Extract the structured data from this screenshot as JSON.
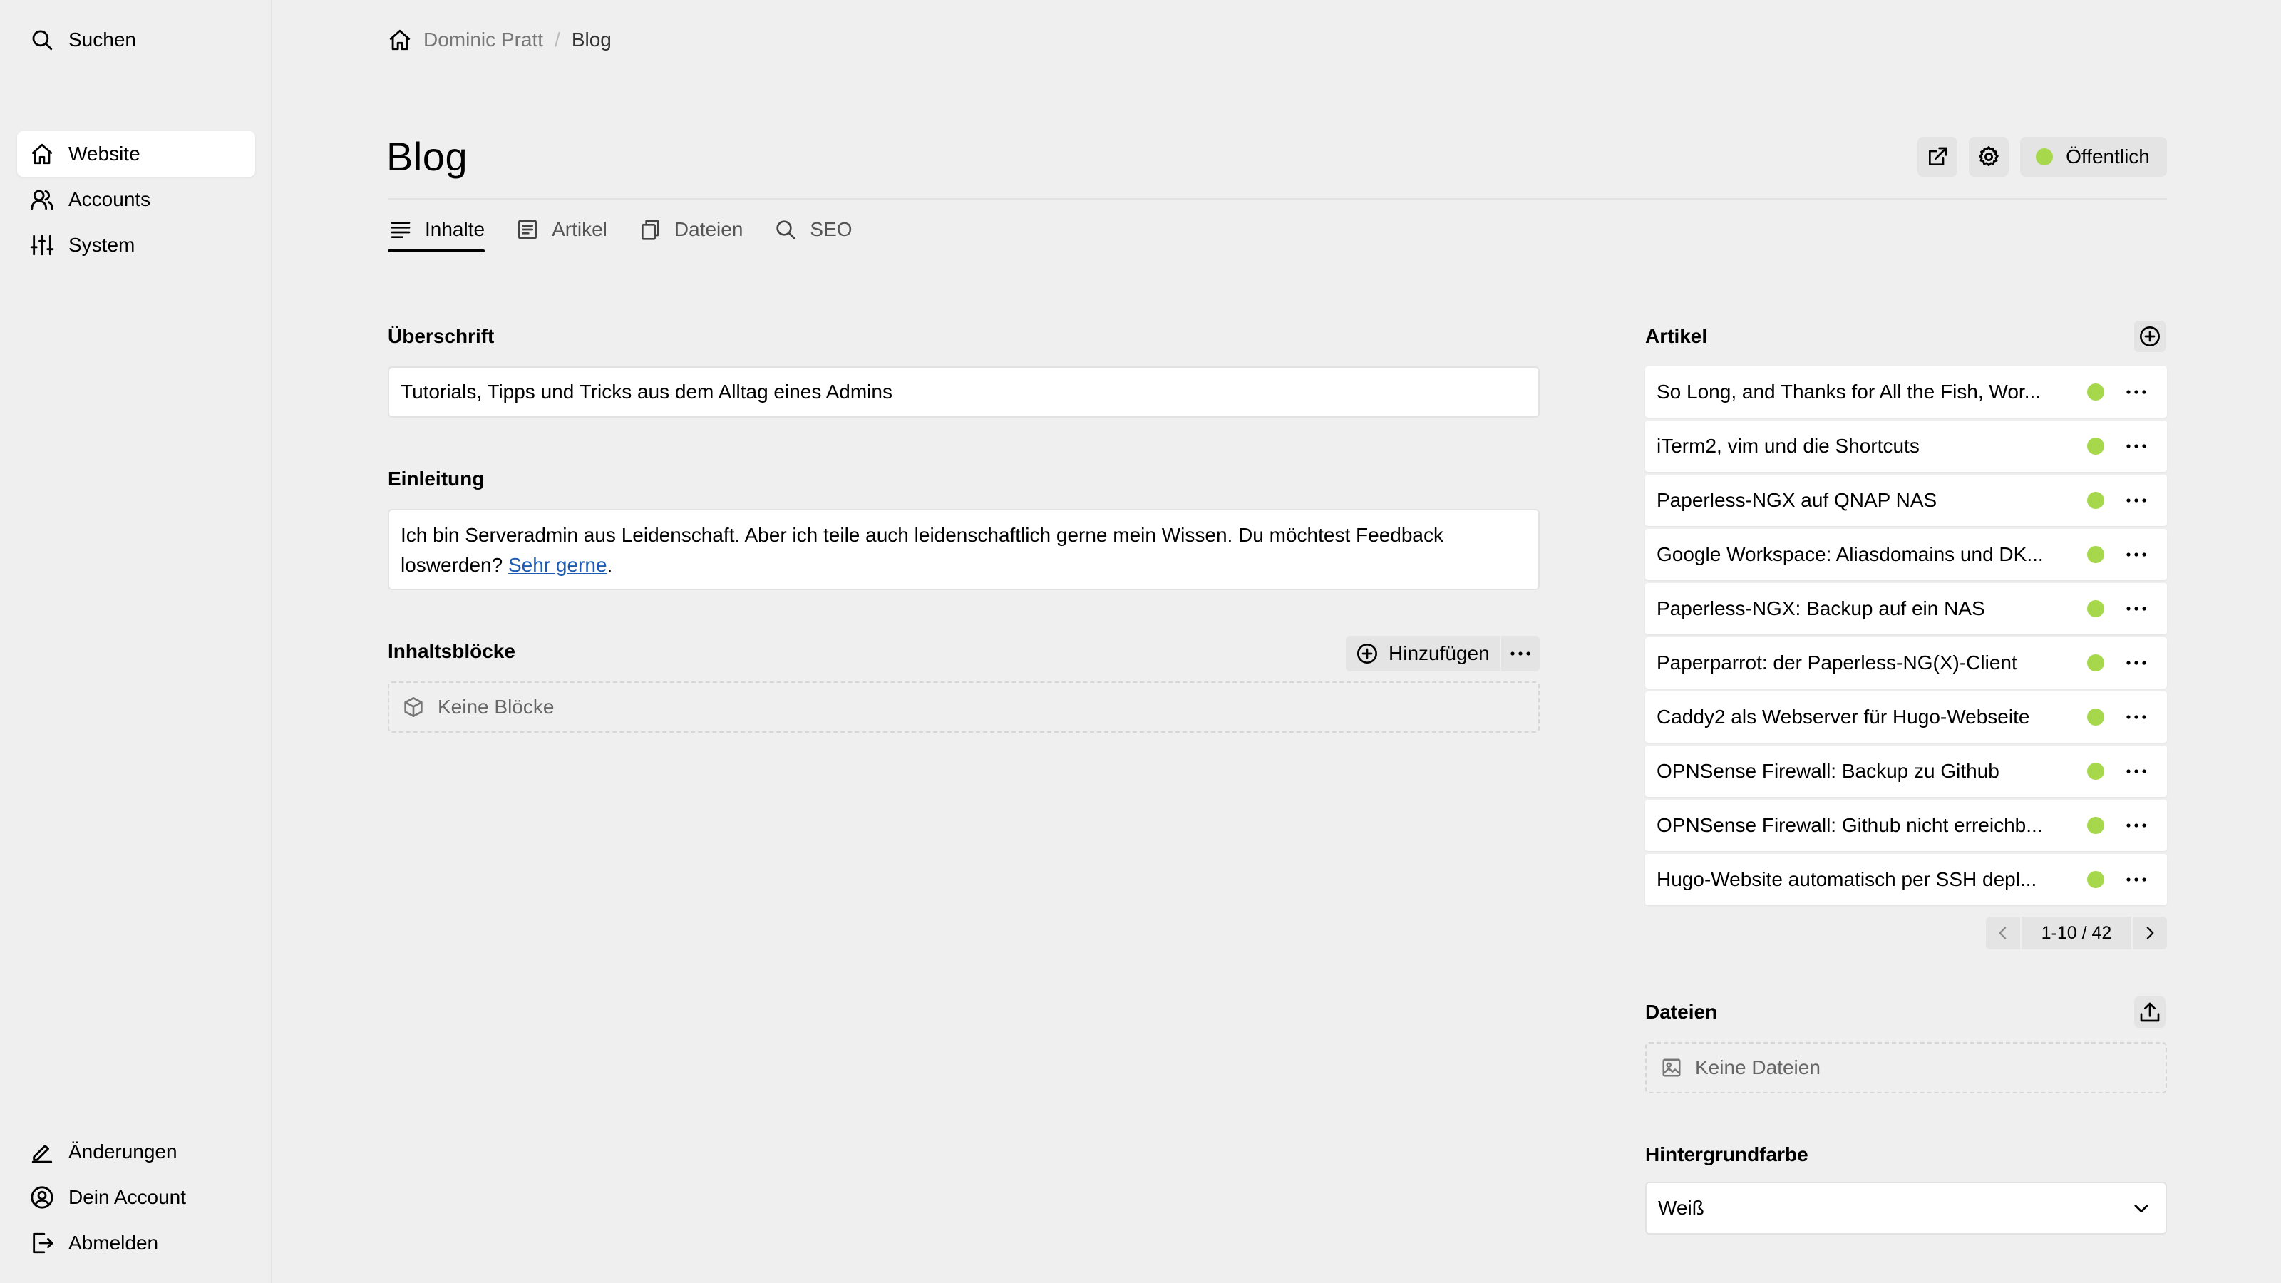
{
  "sidebar": {
    "search_label": "Suchen",
    "nav": [
      {
        "label": "Website",
        "icon": "home-icon",
        "active": true
      },
      {
        "label": "Accounts",
        "icon": "users-icon",
        "active": false
      },
      {
        "label": "System",
        "icon": "sliders-icon",
        "active": false
      }
    ],
    "bottom": [
      {
        "label": "Änderungen",
        "icon": "edit-icon"
      },
      {
        "label": "Dein Account",
        "icon": "user-circle-icon"
      },
      {
        "label": "Abmelden",
        "icon": "logout-icon"
      }
    ]
  },
  "breadcrumb": {
    "root": "Dominic Pratt",
    "separator": "/",
    "current": "Blog"
  },
  "page": {
    "title": "Blog",
    "status_label": "Öffentlich",
    "status_color": "#a7d84c"
  },
  "tabs": [
    {
      "label": "Inhalte",
      "icon": "text-lines-icon",
      "active": true
    },
    {
      "label": "Artikel",
      "icon": "article-icon",
      "active": false
    },
    {
      "label": "Dateien",
      "icon": "copy-icon",
      "active": false
    },
    {
      "label": "SEO",
      "icon": "search-icon",
      "active": false
    }
  ],
  "content": {
    "headline_label": "Überschrift",
    "headline_value": "Tutorials, Tipps und Tricks aus dem Alltag eines Admins",
    "intro_label": "Einleitung",
    "intro_text": "Ich bin Serveradmin aus Leidenschaft. Aber ich teile auch leidenschaftlich gerne mein Wissen. Du möchtest Feedback loswerden? ",
    "intro_link": "Sehr gerne",
    "intro_end": ".",
    "blocks_label": "Inhaltsblöcke",
    "add_label": "Hinzufügen",
    "blocks_empty": "Keine Blöcke"
  },
  "articles": {
    "label": "Artikel",
    "items": [
      {
        "title": "So Long, and Thanks for All the Fish, Wor..."
      },
      {
        "title": "iTerm2, vim und die Shortcuts"
      },
      {
        "title": "Paperless-NGX auf QNAP NAS"
      },
      {
        "title": "Google Workspace: Aliasdomains und DK..."
      },
      {
        "title": "Paperless-NGX: Backup auf ein NAS"
      },
      {
        "title": "Paperparrot: der Paperless-NG(X)-Client"
      },
      {
        "title": "Caddy2 als Webserver für Hugo-Webseite"
      },
      {
        "title": "OPNSense Firewall: Backup zu Github"
      },
      {
        "title": "OPNSense Firewall: Github nicht erreichb..."
      },
      {
        "title": "Hugo-Website automatisch per SSH depl..."
      }
    ],
    "pagination": "1-10 / 42"
  },
  "files": {
    "label": "Dateien",
    "empty": "Keine Dateien"
  },
  "background": {
    "label": "Hintergrundfarbe",
    "value": "Weiß"
  }
}
